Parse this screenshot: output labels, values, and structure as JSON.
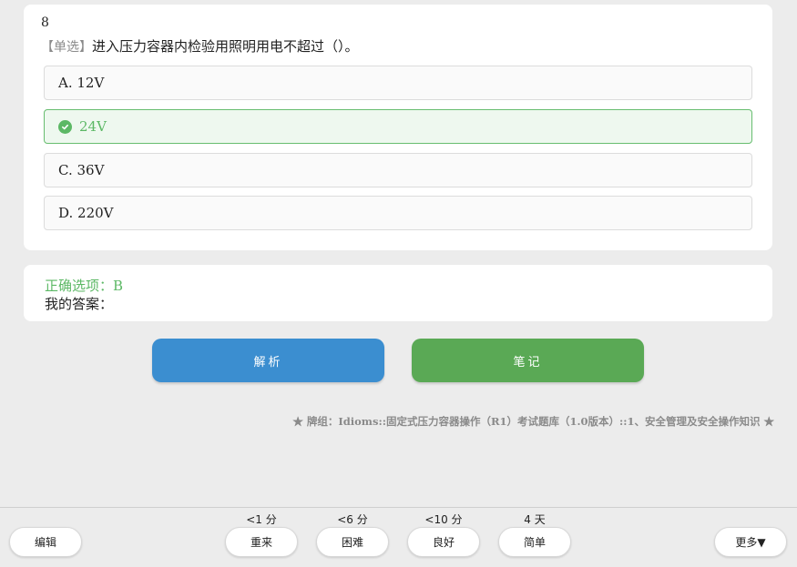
{
  "question": {
    "number": "8",
    "type_tag": "【单选】",
    "text": "进入压力容器内检验用照明用电不超过（）。",
    "options": [
      {
        "label": "A. 12V",
        "correct": false
      },
      {
        "label": "24V",
        "correct": true
      },
      {
        "label": "C. 36V",
        "correct": false
      },
      {
        "label": "D. 220V",
        "correct": false
      }
    ]
  },
  "answer": {
    "correct_label": "正确选项：B",
    "mine_label": "我的答案："
  },
  "actions": {
    "analysis": "解析",
    "note": "笔记"
  },
  "deck_info": "★ 牌组：Idioms::固定式压力容器操作（R1）考试题库（1.0版本）::1、安全管理及安全操作知识 ★",
  "bottom": {
    "edit": "编辑",
    "more": "更多▼",
    "ratings": [
      {
        "time": "<1 分",
        "label": "重来"
      },
      {
        "time": "<6 分",
        "label": "困难"
      },
      {
        "time": "<10 分",
        "label": "良好"
      },
      {
        "time": "4 天",
        "label": "简单"
      }
    ]
  },
  "colors": {
    "correct": "#5cb865",
    "analysis_button": "#3b8ed0",
    "note_button": "#5aa955"
  }
}
